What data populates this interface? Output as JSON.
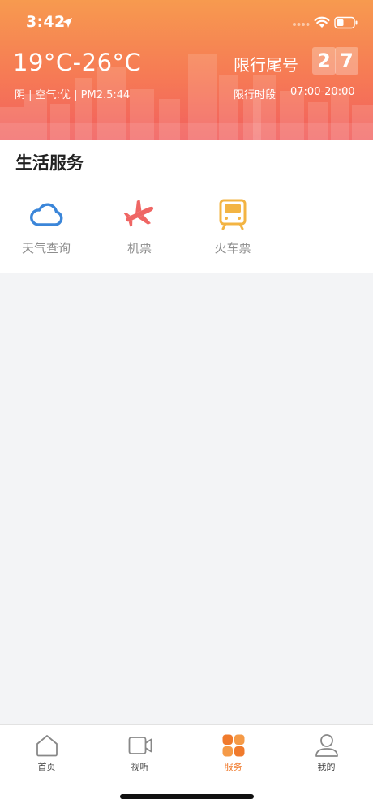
{
  "status_bar": {
    "time": "3:42"
  },
  "weather": {
    "temperature": "19°C-26°C",
    "air_quality": "阴 | 空气:优 | PM2.5:44"
  },
  "traffic_limit": {
    "title": "限行尾号",
    "digits": [
      "2",
      "7"
    ],
    "period_label": "限行时段",
    "period_time": "07:00-20:00"
  },
  "services": {
    "title": "生活服务",
    "items": [
      {
        "label": "天气查询",
        "icon": "cloud-icon",
        "color": "#3b86d9"
      },
      {
        "label": "机票",
        "icon": "airplane-icon",
        "color": "#ef6664"
      },
      {
        "label": "火车票",
        "icon": "train-icon",
        "color": "#f3b443"
      }
    ]
  },
  "tabbar": {
    "items": [
      {
        "label": "首页",
        "icon": "home-icon",
        "active": false
      },
      {
        "label": "视听",
        "icon": "video-icon",
        "active": false
      },
      {
        "label": "服务",
        "icon": "services-grid-icon",
        "active": true
      },
      {
        "label": "我的",
        "icon": "user-icon",
        "active": false
      }
    ],
    "active_color": "#f07a2c"
  }
}
